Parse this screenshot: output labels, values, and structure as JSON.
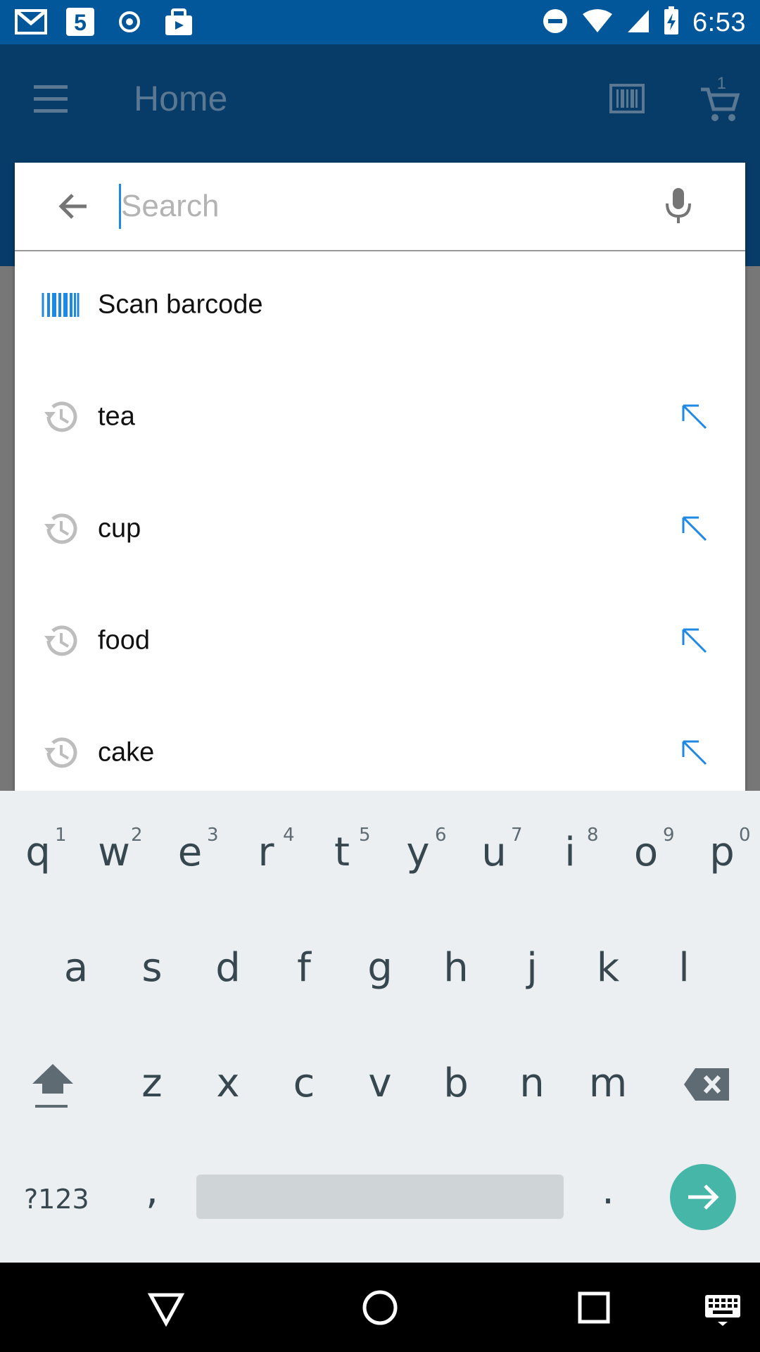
{
  "status_bar": {
    "time": "6:53",
    "left_icons": [
      "gmail-icon",
      "calendar-5-icon",
      "radio-icon",
      "shopping-bag-icon"
    ],
    "right_icons": [
      "do-not-disturb-icon",
      "wifi-icon",
      "signal-icon",
      "battery-charging-icon"
    ]
  },
  "app_bar": {
    "title": "Home",
    "cart_count": "1"
  },
  "search": {
    "placeholder": "Search",
    "value": ""
  },
  "suggestions": [
    {
      "label": "Scan barcode",
      "icon": "barcode-icon"
    },
    {
      "label": "tea",
      "icon": "history-icon"
    },
    {
      "label": "cup",
      "icon": "history-icon"
    },
    {
      "label": "food",
      "icon": "history-icon"
    },
    {
      "label": "cake",
      "icon": "history-icon"
    }
  ],
  "keyboard": {
    "row1": [
      "q",
      "w",
      "e",
      "r",
      "t",
      "y",
      "u",
      "i",
      "o",
      "p"
    ],
    "row1_numbers": [
      "1",
      "2",
      "3",
      "4",
      "5",
      "6",
      "7",
      "8",
      "9",
      "0"
    ],
    "row2": [
      "a",
      "s",
      "d",
      "f",
      "g",
      "h",
      "j",
      "k",
      "l"
    ],
    "row3": [
      "z",
      "x",
      "c",
      "v",
      "b",
      "n",
      "m"
    ],
    "symbols_label": "?123",
    "comma": ",",
    "period": "."
  },
  "colors": {
    "status_bar": "#02579b",
    "app_bar": "#063c67",
    "accent_blue": "#1e88e5",
    "enter_key": "#46b6a8"
  }
}
